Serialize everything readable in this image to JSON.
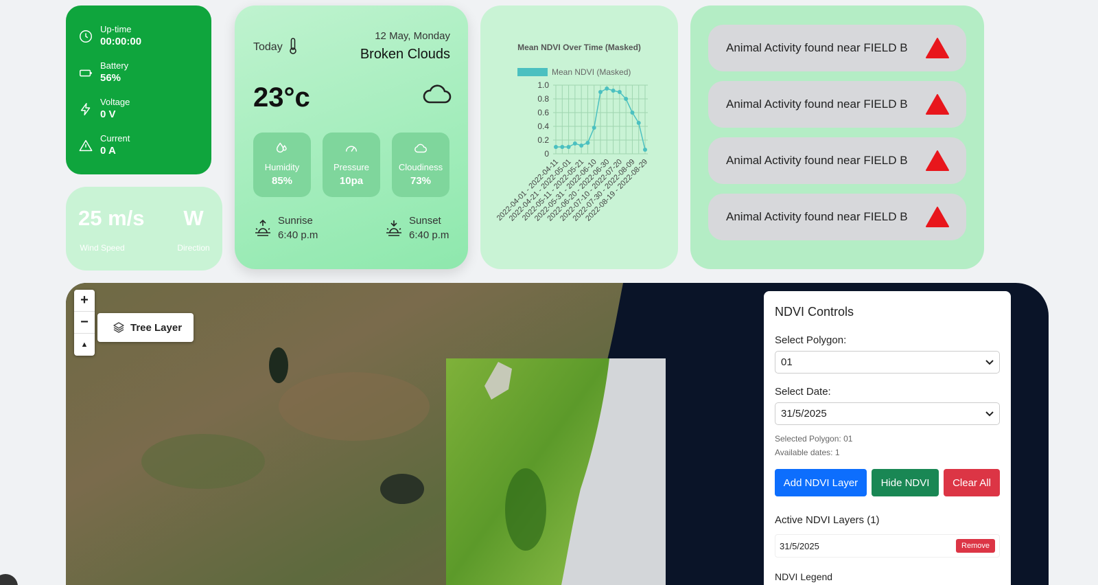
{
  "status": {
    "items": [
      {
        "label": "Up-time",
        "value": "00:00:00",
        "icon": "clock-icon"
      },
      {
        "label": "Battery",
        "value": "56%",
        "icon": "battery-icon"
      },
      {
        "label": "Voltage",
        "value": "0 V",
        "icon": "lightning-icon"
      },
      {
        "label": "Current",
        "value": "0 A",
        "icon": "warning-triangle-icon"
      }
    ]
  },
  "wind": {
    "speed": "25 m/s",
    "speed_label": "Wind Speed",
    "direction": "W",
    "direction_label": "Direction"
  },
  "weather": {
    "today_label": "Today",
    "date": "12 May, Monday",
    "condition": "Broken Clouds",
    "temperature": "23°c",
    "tiles": [
      {
        "label": "Humidity",
        "value": "85%",
        "icon": "drops-icon"
      },
      {
        "label": "Pressure",
        "value": "10pa",
        "icon": "gauge-icon"
      },
      {
        "label": "Cloudiness",
        "value": "73%",
        "icon": "cloud-icon"
      }
    ],
    "sunrise": {
      "label": "Sunrise",
      "time": "6:40 p.m"
    },
    "sunset": {
      "label": "Sunset",
      "time": "6:40 p.m"
    }
  },
  "chart_data": {
    "type": "line",
    "title": "Mean NDVI Over Time (Masked)",
    "series": [
      {
        "name": "Mean NDVI (Masked)",
        "color": "#4bc0c0",
        "values": [
          0.1,
          0.1,
          0.1,
          0.15,
          0.12,
          0.16,
          0.38,
          0.9,
          0.95,
          0.92,
          0.9,
          0.8,
          0.6,
          0.45,
          0.06
        ]
      }
    ],
    "x_tick_labels": [
      "2022-04-01 - 2022-04-11",
      "2022-04-21 - 2022-05-01",
      "2022-05-11 - 2022-05-21",
      "2022-05-31 - 2022-06-10",
      "2022-06-20 - 2022-06-30",
      "2022-07-10 - 2022-07-20",
      "2022-07-30 - 2022-08-09",
      "2022-08-19 - 2022-08-29"
    ],
    "y_ticks": [
      "0",
      "0.2",
      "0.4",
      "0.6",
      "0.8",
      "1.0"
    ],
    "ylim": [
      0,
      1.0
    ],
    "grid": true,
    "legend": "top"
  },
  "alerts": [
    {
      "text": "Animal Activity found near FIELD B"
    },
    {
      "text": "Animal Activity found near FIELD B"
    },
    {
      "text": "Animal Activity found near FIELD B"
    },
    {
      "text": "Animal Activity found near FIELD B"
    }
  ],
  "map": {
    "zoom_in": "+",
    "zoom_out": "−",
    "reset": "▲",
    "layer_button": "Tree Layer"
  },
  "ndvi": {
    "title": "NDVI Controls",
    "polygon_label": "Select Polygon:",
    "polygon_value": "01",
    "date_label": "Select Date:",
    "date_value": "31/5/2025",
    "selected_info": "Selected Polygon: 01",
    "dates_info": "Available dates: 1",
    "add_button": "Add NDVI Layer",
    "hide_button": "Hide NDVI",
    "clear_button": "Clear All",
    "active_label": "Active NDVI Layers (1)",
    "active_layers": [
      {
        "date": "31/5/2025",
        "remove": "Remove"
      }
    ],
    "legend_label": "NDVI Legend",
    "colors": {
      "add": "#0d6efd",
      "hide": "#198754",
      "clear": "#dc3545"
    }
  }
}
